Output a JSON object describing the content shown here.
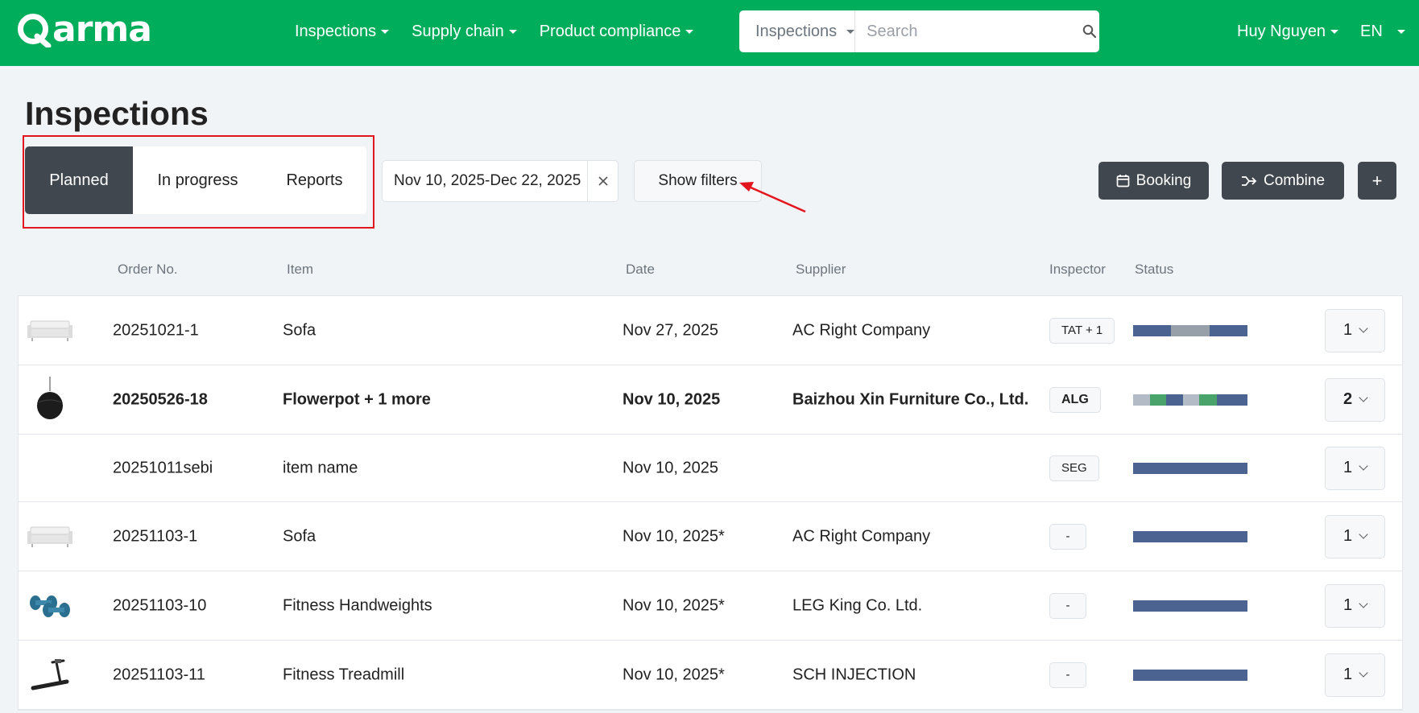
{
  "navbar": {
    "logo_text": "arma",
    "menu": [
      {
        "label": "Inspections"
      },
      {
        "label": "Supply chain"
      },
      {
        "label": "Product compliance"
      }
    ],
    "search": {
      "scope": "Inspections",
      "placeholder": "Search"
    },
    "user": "Huy Nguyen",
    "language": "EN"
  },
  "page": {
    "title": "Inspections",
    "tabs": [
      {
        "label": "Planned",
        "active": true
      },
      {
        "label": "In progress",
        "active": false
      },
      {
        "label": "Reports",
        "active": false
      }
    ],
    "date_range": "Nov 10, 2025-Dec 22, 2025",
    "show_filters": "Show filters",
    "actions": {
      "booking": "Booking",
      "combine": "Combine",
      "add": "+"
    }
  },
  "table": {
    "headers": {
      "order_no": "Order No.",
      "item": "Item",
      "date": "Date",
      "supplier": "Supplier",
      "inspector": "Inspector",
      "status": "Status"
    },
    "rows": [
      {
        "thumb": "sofa",
        "order_no": "20251021-1",
        "item": "Sofa",
        "date": "Nov 27, 2025",
        "supplier": "AC Right Company",
        "inspector": "TAT + 1",
        "qty": "1",
        "bold": false,
        "status": [
          {
            "color": "#4b6391",
            "share": 0.33
          },
          {
            "color": "#97a0a8",
            "share": 0.34
          },
          {
            "color": "#4b6391",
            "share": 0.33
          }
        ]
      },
      {
        "thumb": "flowerpot",
        "order_no": "20250526-18",
        "item": "Flowerpot + 1 more",
        "date": "Nov 10, 2025",
        "supplier": "Baizhou Xin Furniture Co., Ltd.",
        "inspector": "ALG",
        "qty": "2",
        "bold": true,
        "status": [
          {
            "color": "#b3bcc6",
            "share": 0.15
          },
          {
            "color": "#4aa36a",
            "share": 0.14
          },
          {
            "color": "#4b6391",
            "share": 0.15
          },
          {
            "color": "#b3bcc6",
            "share": 0.14
          },
          {
            "color": "#4aa36a",
            "share": 0.15
          },
          {
            "color": "#4b6391",
            "share": 0.27
          }
        ]
      },
      {
        "thumb": "",
        "order_no": "20251011sebi",
        "item": "item name",
        "date": "Nov 10, 2025",
        "supplier": "",
        "inspector": "SEG",
        "qty": "1",
        "bold": false,
        "status": [
          {
            "color": "#4b6391",
            "share": 1
          }
        ]
      },
      {
        "thumb": "sofa",
        "order_no": "20251103-1",
        "item": "Sofa",
        "date": "Nov 10, 2025*",
        "supplier": "AC Right Company",
        "inspector": "-",
        "qty": "1",
        "bold": false,
        "status": [
          {
            "color": "#4b6391",
            "share": 1
          }
        ]
      },
      {
        "thumb": "dumbbells",
        "order_no": "20251103-10",
        "item": "Fitness Handweights",
        "date": "Nov 10, 2025*",
        "supplier": "LEG King Co. Ltd.",
        "inspector": "-",
        "qty": "1",
        "bold": false,
        "status": [
          {
            "color": "#4b6391",
            "share": 1
          }
        ]
      },
      {
        "thumb": "treadmill",
        "order_no": "20251103-11",
        "item": "Fitness Treadmill",
        "date": "Nov 10, 2025*",
        "supplier": "SCH INJECTION",
        "inspector": "-",
        "qty": "1",
        "bold": false,
        "status": [
          {
            "color": "#4b6391",
            "share": 1
          }
        ]
      }
    ]
  },
  "colors": {
    "brand": "#00ad5b",
    "dark_button": "#41474f",
    "annotation": "#e3161d"
  }
}
